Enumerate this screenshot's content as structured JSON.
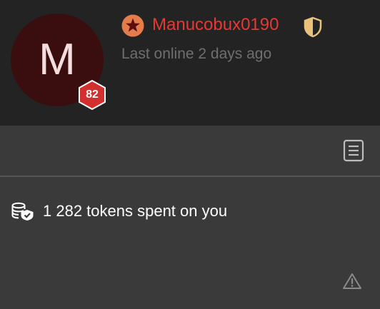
{
  "profile": {
    "avatar_initial": "M",
    "level": "82",
    "username": "Manucobux0190",
    "last_online": "Last online 2 days ago"
  },
  "tokens": {
    "summary": "1 282 tokens spent on you"
  },
  "icons": {
    "status_star": "star-icon",
    "shield": "shield-icon",
    "notes": "notes-icon",
    "coins": "coins-icon",
    "report": "warning-icon"
  },
  "colors": {
    "header_bg": "#232323",
    "body_bg": "#3a3a3a",
    "avatar_bg": "#3a0e0e",
    "username": "#e53935",
    "level_badge": "#d32f2f",
    "star_badge": "#e57c4c",
    "shield_gold": "#e8c17a"
  }
}
